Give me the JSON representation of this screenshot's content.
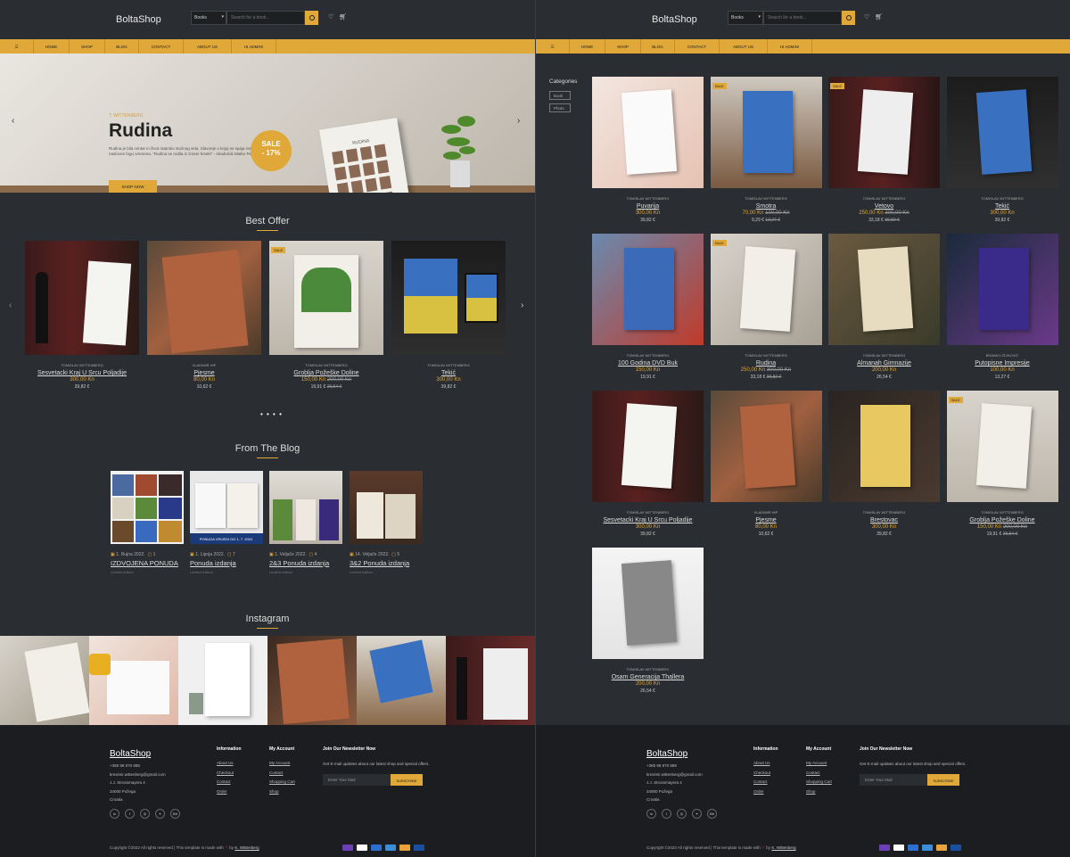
{
  "brand": {
    "name": "BoltaShop"
  },
  "search": {
    "category": "Books",
    "placeholder": "Search for a book..."
  },
  "nav": {
    "items": [
      "☰",
      "HOME",
      "SHOP",
      "BLOG",
      "CONTACT",
      "ABOUT US",
      "HI ADMIN!"
    ]
  },
  "hero": {
    "author": "T. WITTENBERG",
    "title": "Rudina",
    "description": "Rudina je bila centar in život ratarsko stočnog sela. Slavonje u kojoj se spaja sve sto naslovne fogu vremena. \"Rudina se rudila iz zrneni hrseki\" - Akademik Matko Peic",
    "button": "SHOP NOW",
    "sale_badge": "SALE",
    "sale_percent": "- 17%",
    "book_title": "RUDINA"
  },
  "best_offer": {
    "title": "Best Offer",
    "products": [
      {
        "author": "TOMISLAV WITTENBERG",
        "title": "Sesvetacki Kraj U Srcu Poljadije",
        "price": "300,00 Kn",
        "old_price": "",
        "eur": "39,82 €",
        "old_eur": "",
        "sale": ""
      },
      {
        "author": "VLADIMIR HIP",
        "title": "Pjesme",
        "price": "80,00 Kn",
        "old_price": "",
        "eur": "10,62 €",
        "old_eur": "",
        "sale": ""
      },
      {
        "author": "TOMISLAV WITTENBERG",
        "title": "Groblja Požeške Doline",
        "price": "150,00 Kn",
        "old_price": "200,00 Kn",
        "eur": "19,91 €",
        "old_eur": "26,54 €",
        "sale": "SALE"
      },
      {
        "author": "TOMISLAV WITTENBERG",
        "title": "Tekić",
        "price": "300,00 Kn",
        "old_price": "",
        "eur": "39,82 €",
        "old_eur": "",
        "sale": ""
      }
    ]
  },
  "blog": {
    "title": "From The Blog",
    "posts": [
      {
        "date": "1. Rujna 2022.",
        "comments": "1",
        "title": "IZDVOJENA PONUDA",
        "excerpt": "Limited edition"
      },
      {
        "date": "1. Lipnja 2022.",
        "comments": "7",
        "title": "Ponuda izdanja",
        "excerpt": "Limited edition"
      },
      {
        "date": "1. Veljače 2022.",
        "comments": "4",
        "title": "2&3 Ponuda izdanja",
        "excerpt": "Limited edition"
      },
      {
        "date": "14. Veljače 2022.",
        "comments": "5",
        "title": "3&2 Ponuda izdanja",
        "excerpt": "Limited edition"
      }
    ],
    "banner": "PONUDA VRIJEDI DO 1. 7. 2022."
  },
  "instagram": {
    "title": "Instagram"
  },
  "shop": {
    "categories_title": "Categories",
    "categories": [
      "Book",
      "Photo"
    ],
    "products": [
      {
        "author": "TOMISLAV WITTENBERG",
        "title": "Puvarija",
        "price": "300,00 Kn",
        "old_price": "",
        "eur": "39,82 €",
        "old_eur": "",
        "sale": ""
      },
      {
        "author": "TOMISLAV WITTENBERG",
        "title": "Smotra",
        "price": "70,00 Kn",
        "old_price": "100,00 Kn",
        "eur": "9,29 €",
        "old_eur": "13,27 €",
        "sale": "SALE"
      },
      {
        "author": "TOMISLAV WITTENBERG",
        "title": "Vetovo",
        "price": "250,00 Kn",
        "old_price": "300,00 Kn",
        "eur": "33,18 €",
        "old_eur": "39,82 €",
        "sale": "SALE"
      },
      {
        "author": "TOMISLAV WITTENBERG",
        "title": "Tekić",
        "price": "300,00 Kn",
        "old_price": "",
        "eur": "39,82 €",
        "old_eur": "",
        "sale": ""
      },
      {
        "author": "TOMISLAV WITTENBERG",
        "title": "100 Godina DVD Buk",
        "price": "150,00 Kn",
        "old_price": "",
        "eur": "19,91 €",
        "old_eur": "",
        "sale": ""
      },
      {
        "author": "TOMISLAV WITTENBERG",
        "title": "Rudina",
        "price": "250,00 Kn",
        "old_price": "300,00 Kn",
        "eur": "33,18 €",
        "old_eur": "39,82 €",
        "sale": "SALE"
      },
      {
        "author": "TOMISLAV WITTENBERG",
        "title": "Almanah Gimnazije",
        "price": "200,00 Kn",
        "old_price": "",
        "eur": "26,54 €",
        "old_eur": "",
        "sale": ""
      },
      {
        "author": "BRANKO ŽIVKOVIĆ",
        "title": "Putopisne Impresije",
        "price": "100,00 Kn",
        "old_price": "",
        "eur": "13,27 €",
        "old_eur": "",
        "sale": ""
      },
      {
        "author": "TOMISLAV WITTENBERG",
        "title": "Sesvetacki Kraj U Srcu Poljadije",
        "price": "300,00 Kn",
        "old_price": "",
        "eur": "39,82 €",
        "old_eur": "",
        "sale": ""
      },
      {
        "author": "VLADIMIR HIP",
        "title": "Pjesme",
        "price": "80,00 Kn",
        "old_price": "",
        "eur": "10,62 €",
        "old_eur": "",
        "sale": ""
      },
      {
        "author": "TOMISLAV WITTENBERG",
        "title": "Brestovac",
        "price": "300,00 Kn",
        "old_price": "",
        "eur": "39,82 €",
        "old_eur": "",
        "sale": ""
      },
      {
        "author": "TOMISLAV WITTENBERG",
        "title": "Groblja Požeške Doline",
        "price": "150,00 Kn",
        "old_price": "200,00 Kn",
        "eur": "19,91 €",
        "old_eur": "26,54 €",
        "sale": "SALE"
      },
      {
        "author": "TOMISLAV WITTENBERG",
        "title": "Osam Generacija Thallera",
        "price": "200,00 Kn",
        "old_price": "",
        "eur": "26,54 €",
        "old_eur": "",
        "sale": ""
      }
    ]
  },
  "footer": {
    "logo": "BoltaShop",
    "phone": "+385 98 870 888",
    "email": "kresimir.wittenberg@gmail.com",
    "address": "J.J. Strossmayera 4",
    "city": "34000 Požega",
    "country": "Croatia",
    "info_title": "Information",
    "info_links": [
      "About Us",
      "Checkout",
      "Contact",
      "Order"
    ],
    "account_title": "My Account",
    "account_links": [
      "My Account",
      "Contact",
      "Shopping Cart",
      "Shop"
    ],
    "newsletter_title": "Join Our Newsletter Now",
    "newsletter_text": "Get E-mail updates about our latest shop and special offers.",
    "email_placeholder": "Enter Your Mail",
    "subscribe": "SUBSCRIBE",
    "social": [
      "in",
      "f",
      "◎",
      "⚭",
      "Bē"
    ],
    "copyright": "Copyright ©2022 All rights reserved | This template is made with",
    "by": "by",
    "author_link": "K. Wittenberg",
    "payments": [
      "#6c3fb5",
      "#ffffff",
      "#2c6fd1",
      "#3a8fd8",
      "#e8a33a",
      "#1a4fa0"
    ]
  },
  "colors": {
    "accent": "#e0a838",
    "bg": "#2a2d31",
    "footer": "#1c1d20"
  }
}
